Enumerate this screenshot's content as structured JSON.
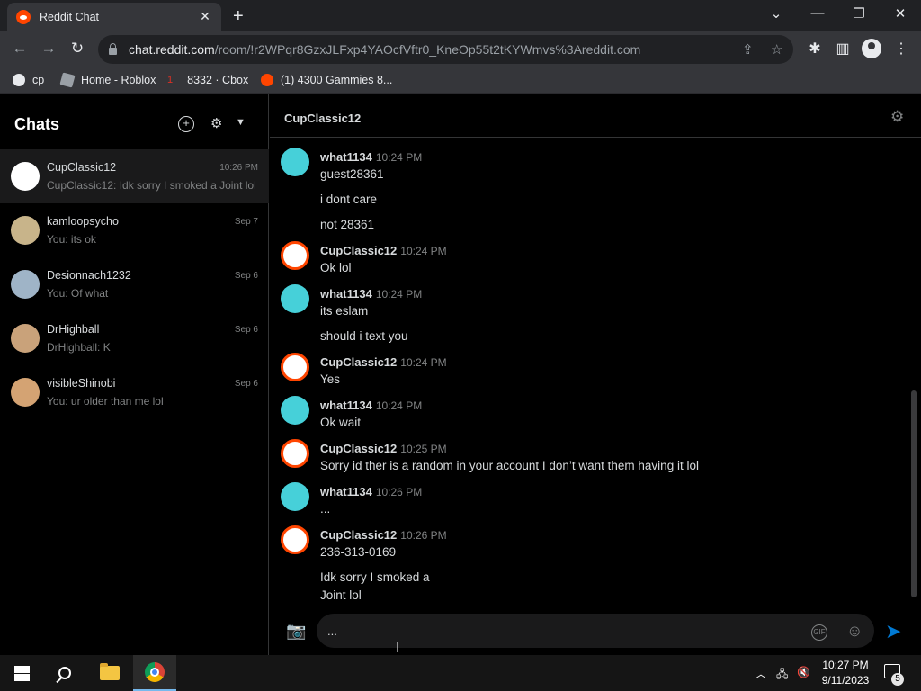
{
  "browser": {
    "tab_title": "Reddit Chat",
    "tab_close": "✕",
    "new_tab": "+",
    "url_host": "chat.reddit.com",
    "url_path": "/room/!r2WPqr8GzxJLFxp4YAOcfVftr0_KneOp55t2tKYWmvs%3Areddit.com",
    "bookmarks": [
      {
        "label": "cp",
        "color": "#e8eaed"
      },
      {
        "label": "Home - Roblox",
        "color": "#9aa0a6"
      },
      {
        "label": "8332 · Cbox",
        "color": "#d93025"
      },
      {
        "label": "(1) 4300 Gammies 8...",
        "color": "#ff4500"
      }
    ]
  },
  "sidebar": {
    "title": "Chats",
    "chats": [
      {
        "name": "CupClassic12",
        "time": "10:26 PM",
        "preview": "CupClassic12: Idk sorry I smoked a Joint lol",
        "avatar_color": "#ffffff",
        "active": true
      },
      {
        "name": "kamloopsycho",
        "time": "Sep 7",
        "preview": "You: its ok",
        "avatar_color": "#c8b48a"
      },
      {
        "name": "Desionnach1232",
        "time": "Sep 6",
        "preview": "You: Of what",
        "avatar_color": "#9fb4c7"
      },
      {
        "name": "DrHighball",
        "time": "Sep 6",
        "preview": "DrHighball: K",
        "avatar_color": "#c9a27a"
      },
      {
        "name": "visibleShinobi",
        "time": "Sep 6",
        "preview": "You: ur older than me lol",
        "avatar_color": "#d4a373"
      }
    ]
  },
  "conversation": {
    "title": "CupClassic12",
    "messages": [
      {
        "user": "what1134",
        "time": "10:24 PM",
        "lines": [
          "guest28361",
          "i dont care",
          "not 28361"
        ],
        "avatar": "cyan"
      },
      {
        "user": "CupClassic12",
        "time": "10:24 PM",
        "lines": [
          "Ok lol"
        ],
        "avatar": "red"
      },
      {
        "user": "what1134",
        "time": "10:24 PM",
        "lines": [
          "its eslam",
          "should i text you"
        ],
        "avatar": "cyan"
      },
      {
        "user": "CupClassic12",
        "time": "10:24 PM",
        "lines": [
          "Yes"
        ],
        "avatar": "red"
      },
      {
        "user": "what1134",
        "time": "10:24 PM",
        "lines": [
          "Ok wait"
        ],
        "avatar": "cyan"
      },
      {
        "user": "CupClassic12",
        "time": "10:25 PM",
        "lines": [
          "Sorry id ther is a random in your account I don’t want them having it lol"
        ],
        "avatar": "red"
      },
      {
        "user": "what1134",
        "time": "10:26 PM",
        "lines": [
          "..."
        ],
        "avatar": "cyan"
      },
      {
        "user": "CupClassic12",
        "time": "10:26 PM",
        "lines": [
          "236-313-0169",
          "Idk sorry I smoked a\nJoint lol"
        ],
        "avatar": "red"
      }
    ],
    "input_value": "...",
    "gif_label": "GIF"
  },
  "taskbar": {
    "time": "10:27 PM",
    "date": "9/11/2023",
    "notification_count": "5"
  },
  "colors": {
    "accent": "#0079d3",
    "cyan_avatar": "#46d0d9",
    "red_avatar": "#ff4500"
  }
}
